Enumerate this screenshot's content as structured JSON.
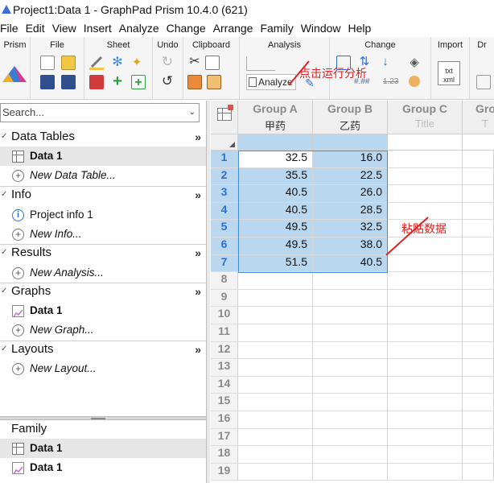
{
  "window": {
    "title": "Project1:Data 1 - GraphPad Prism 10.4.0 (621)"
  },
  "menu": [
    "File",
    "Edit",
    "View",
    "Insert",
    "Analyze",
    "Change",
    "Arrange",
    "Family",
    "Window",
    "Help"
  ],
  "ribbon": {
    "groups": [
      "Prism",
      "File",
      "Sheet",
      "Undo",
      "Clipboard",
      "Analysis",
      "Change",
      "Import",
      "Dr"
    ],
    "analyze_label": "Analyze",
    "num_format_label": "1.23"
  },
  "navigator": {
    "search_placeholder": "Search...",
    "sections": [
      {
        "title": "Data Tables",
        "items": [
          {
            "label": "Data 1",
            "icon": "table-icon"
          },
          {
            "label": "New Data Table...",
            "icon": "plus-circle-icon"
          }
        ]
      },
      {
        "title": "Info",
        "items": [
          {
            "label": "Project info 1",
            "icon": "info-icon"
          },
          {
            "label": "New Info...",
            "icon": "plus-circle-icon"
          }
        ]
      },
      {
        "title": "Results",
        "items": [
          {
            "label": "New Analysis...",
            "icon": "plus-circle-icon"
          }
        ]
      },
      {
        "title": "Graphs",
        "items": [
          {
            "label": "Data 1",
            "icon": "graph-icon"
          },
          {
            "label": "New Graph...",
            "icon": "plus-circle-icon"
          }
        ]
      },
      {
        "title": "Layouts",
        "items": [
          {
            "label": "New Layout...",
            "icon": "plus-circle-icon"
          }
        ]
      }
    ],
    "more_glyph": "»",
    "family": {
      "title": "Family",
      "items": [
        {
          "label": "Data 1",
          "icon": "table-icon"
        },
        {
          "label": "Data 1",
          "icon": "graph-icon"
        }
      ]
    }
  },
  "sheet": {
    "columns": [
      {
        "title": "Group A",
        "subtitle": "甲药"
      },
      {
        "title": "Group B",
        "subtitle": "乙药"
      },
      {
        "title": "Group C",
        "subtitle": "Title"
      },
      {
        "title": "Gro",
        "subtitle": "T"
      }
    ],
    "rows": [
      "1",
      "2",
      "3",
      "4",
      "5",
      "6",
      "7",
      "8",
      "9",
      "10",
      "11",
      "12",
      "13",
      "14",
      "15",
      "16",
      "17",
      "18",
      "19"
    ],
    "values": [
      [
        "32.5",
        "16.0"
      ],
      [
        "35.5",
        "22.5"
      ],
      [
        "40.5",
        "26.0"
      ],
      [
        "40.5",
        "28.5"
      ],
      [
        "49.5",
        "32.5"
      ],
      [
        "49.5",
        "38.0"
      ],
      [
        "51.5",
        "40.5"
      ]
    ]
  },
  "annotations": {
    "run_analysis": "点击运行分析",
    "paste_data": "粘贴数据"
  },
  "colors": {
    "accent": "#2e6fd0",
    "selection": "#b9d7ee",
    "annotation": "#e02020"
  }
}
